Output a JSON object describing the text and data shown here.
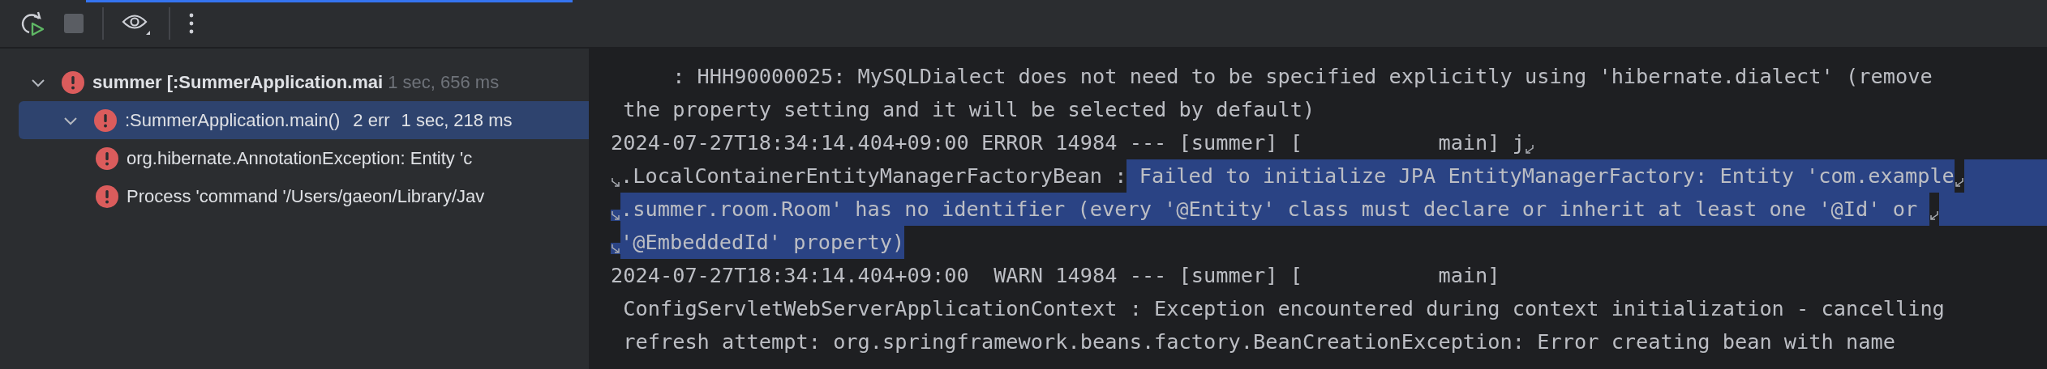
{
  "toolbar": {
    "stop_enabled": false
  },
  "tree": [
    {
      "label": "summer [:SummerApplication.mai",
      "time": "1 sec, 656 ms",
      "kind": "error",
      "expanded": true,
      "selected": false,
      "children": [
        {
          "label": ":SummerApplication.main()",
          "count": "2 err",
          "time": "1 sec, 218 ms",
          "kind": "error",
          "expanded": true,
          "selected": true,
          "children": [
            {
              "label": "org.hibernate.AnnotationException: Entity 'c",
              "kind": "error",
              "selected": false
            },
            {
              "label": "Process 'command '/Users/gaeon/Library/Jav",
              "kind": "error",
              "selected": false
            }
          ]
        }
      ]
    }
  ],
  "console": [
    {
      "wrap_start": false,
      "wrap_end": false,
      "segments": [
        {
          "text": "     : HHH90000025: MySQLDialect does not need to be specified explicitly using 'hibernate.dialect' (remove",
          "selected": false
        }
      ]
    },
    {
      "wrap_start": false,
      "wrap_end": false,
      "segments": [
        {
          "text": " the property setting and it will be selected by default)",
          "selected": false
        }
      ]
    },
    {
      "wrap_start": false,
      "wrap_end": true,
      "segments": [
        {
          "text": "2024-07-27T18:34:14.404+09:00 ERROR 14984 --- [summer] [           main] j",
          "selected": false
        }
      ]
    },
    {
      "wrap_start": true,
      "wrap_end": true,
      "fill": true,
      "segments": [
        {
          "text": ".LocalContainerEntityManagerFactoryBean :",
          "selected": false
        },
        {
          "text": " Failed to initialize JPA EntityManagerFactory: Entity 'com.example",
          "selected": true
        }
      ]
    },
    {
      "wrap_start": true,
      "wrap_end": true,
      "fill": true,
      "segments": [
        {
          "text": ".summer.room.Room' has no identifier (every '@Entity' class must declare or inherit at least one '@Id' or ",
          "selected": true
        }
      ]
    },
    {
      "wrap_start": true,
      "wrap_end": false,
      "fill": false,
      "segments": [
        {
          "text": "'@EmbeddedId' property)",
          "selected": true
        }
      ]
    },
    {
      "wrap_start": false,
      "wrap_end": false,
      "segments": [
        {
          "text": "2024-07-27T18:34:14.404+09:00  WARN 14984 --- [summer] [           main]",
          "selected": false
        }
      ]
    },
    {
      "wrap_start": false,
      "wrap_end": false,
      "segments": [
        {
          "text": " ConfigServletWebServerApplicationContext : Exception encountered during context initialization - cancelling",
          "selected": false
        }
      ]
    },
    {
      "wrap_start": false,
      "wrap_end": false,
      "segments": [
        {
          "text": " refresh attempt: org.springframework.beans.factory.BeanCreationException: Error creating bean with name",
          "selected": false
        }
      ]
    }
  ]
}
